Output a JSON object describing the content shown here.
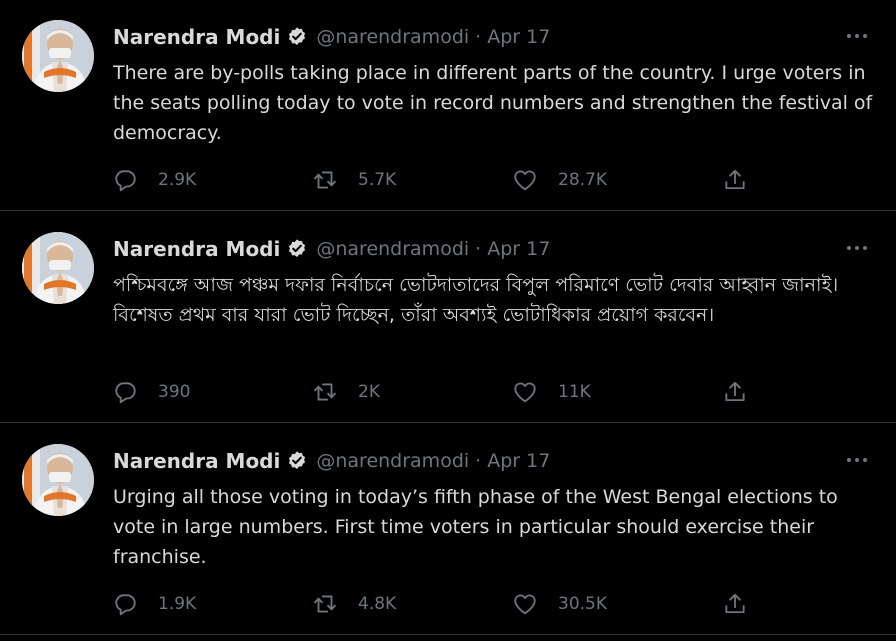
{
  "colors": {
    "background": "#000000",
    "text": "#d9d9d9",
    "muted": "#6e767d",
    "divider": "#2f3336"
  },
  "icons": {
    "verified": "verified-badge-icon",
    "more": "more-options-icon",
    "reply": "reply-icon",
    "retweet": "retweet-icon",
    "like": "like-icon",
    "share": "share-icon"
  },
  "tweets": [
    {
      "author": "Narendra Modi",
      "handle": "@narendramodi",
      "separator": "·",
      "date": "Apr 17",
      "text": "There are by-polls taking place in different parts of the country. I urge voters in the seats polling today to vote in record numbers and strengthen the festival of democracy.",
      "replies": "2.9K",
      "retweets": "5.7K",
      "likes": "28.7K"
    },
    {
      "author": "Narendra Modi",
      "handle": "@narendramodi",
      "separator": "·",
      "date": "Apr 17",
      "text": "পশ্চিমবঙ্গে আজ পঞ্চম দফার নির্বাচনে ভোটদাতাদের বিপুল পরিমাণে ভোট দেবার আহ্বান জানাই। বিশেষত প্রথম বার যারা ভোট দিচ্ছেন, তাঁরা অবশ্যই ভোটাধিকার প্রয়োগ করবেন।",
      "replies": "390",
      "retweets": "2K",
      "likes": "11K"
    },
    {
      "author": "Narendra Modi",
      "handle": "@narendramodi",
      "separator": "·",
      "date": "Apr 17",
      "text": "Urging all those voting in today’s fifth phase of the West Bengal elections to vote in large numbers. First time voters in particular should exercise their franchise.",
      "replies": "1.9K",
      "retweets": "4.8K",
      "likes": "30.5K"
    }
  ]
}
